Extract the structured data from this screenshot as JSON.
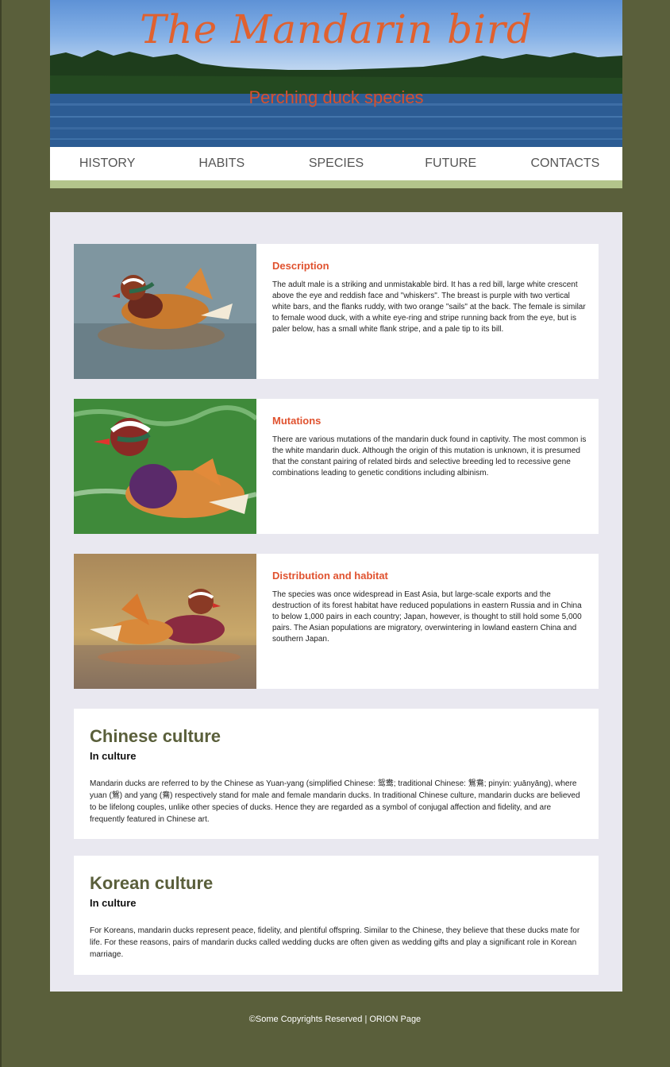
{
  "header": {
    "title": "The Mandarin bird",
    "subtitle": "Perching duck species"
  },
  "nav": {
    "items": [
      "HISTORY",
      "HABITS",
      "SPECIES",
      "FUTURE",
      "CONTACTS"
    ]
  },
  "cards": [
    {
      "title": "Description",
      "body": "The adult male is a striking and unmistakable bird. It has a red bill, large white crescent above the eye and reddish face and \"whiskers\". The breast is purple with two vertical white bars, and the flanks ruddy, with two orange \"sails\" at the back. The female is similar to female wood duck, with a white eye-ring and stripe running back from the eye, but is paler below, has a small white flank stripe, and a pale tip to its bill.",
      "image_icon": "duck-photo"
    },
    {
      "title": "Mutations",
      "body": "There are various mutations of the mandarin duck found in captivity. The most common is the white mandarin duck. Although the origin of this mutation is unknown, it is presumed that the constant pairing of related birds and selective breeding led to recessive gene combinations leading to genetic conditions including albinism.",
      "image_icon": "duck-photo"
    },
    {
      "title": "Distribution and habitat",
      "body": "The species was once widespread in East Asia, but large-scale exports and the destruction of its forest habitat have reduced populations in eastern Russia and in China to below 1,000 pairs in each country; Japan, however, is thought to still hold some 5,000 pairs. The Asian populations are migratory, overwintering in lowland eastern China and southern Japan.",
      "image_icon": "duck-pair-photo"
    }
  ],
  "culture": [
    {
      "title": "Chinese culture",
      "subtitle": "In culture",
      "body": "Mandarin ducks are referred to by the Chinese as Yuan-yang (simplified Chinese: 鸳鸯; traditional Chinese: 鴛鴦; pinyin: yuānyāng), where yuan (鴛) and yang (鴦) respectively stand for male and female mandarin ducks. In traditional Chinese culture, mandarin ducks are believed to be lifelong couples, unlike other species of ducks. Hence they are regarded as a symbol of conjugal affection and fidelity, and are frequently featured in Chinese art."
    },
    {
      "title": "Korean culture",
      "subtitle": "In culture",
      "body": "For Koreans, mandarin ducks represent peace, fidelity, and plentiful offspring. Similar to the Chinese, they believe that these ducks mate for life. For these reasons, pairs of mandarin ducks called wedding ducks are often given as wedding gifts and play a significant role in Korean marriage."
    }
  ],
  "footer": {
    "text": "©Some Copyrights Reserved | ORION Page"
  },
  "colors": {
    "background": "#5a5f3b",
    "accent": "#e0522f",
    "nav_bar": "#b3c48b",
    "content_bg": "#e9e8f0"
  }
}
